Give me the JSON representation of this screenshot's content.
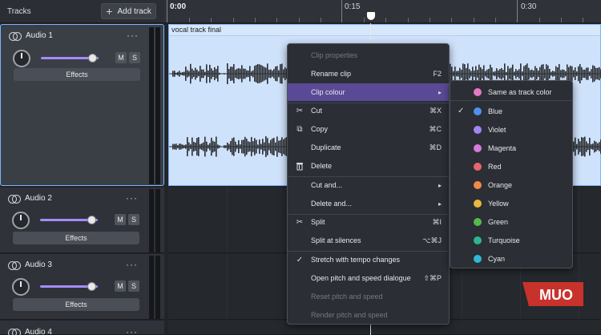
{
  "header": {
    "title": "Tracks",
    "add_track_label": "Add track"
  },
  "timeline": {
    "labels": [
      "0:00",
      "0:15",
      "0:30"
    ]
  },
  "tracks": [
    {
      "name": "Audio 1",
      "mute": "M",
      "solo": "S",
      "effects": "Effects",
      "menu": "···",
      "volume": 0.9
    },
    {
      "name": "Audio 2",
      "mute": "M",
      "solo": "S",
      "effects": "Effects",
      "menu": "···",
      "volume": 0.9
    },
    {
      "name": "Audio 3",
      "mute": "M",
      "solo": "S",
      "effects": "Effects",
      "menu": "···",
      "volume": 0.9
    },
    {
      "name": "Audio 4",
      "menu": "···"
    }
  ],
  "clip": {
    "title": "vocal track final",
    "color": "#cfe2fb"
  },
  "context_menu": {
    "items": [
      {
        "label": "Clip properties",
        "shortcut": "",
        "disabled": true
      },
      {
        "label": "Rename clip",
        "shortcut": "F2"
      },
      {
        "label": "Clip colour",
        "shortcut": "▸",
        "highlight": true
      },
      {
        "label": "Cut",
        "shortcut": "⌘X",
        "icon": "scissors-icon"
      },
      {
        "label": "Copy",
        "shortcut": "⌘C",
        "icon": "copy-icon"
      },
      {
        "label": "Duplicate",
        "shortcut": "⌘D"
      },
      {
        "label": "Delete",
        "shortcut": "",
        "icon": "trash-icon"
      },
      {
        "label": "Cut and...",
        "shortcut": "▸"
      },
      {
        "label": "Delete and...",
        "shortcut": "▸"
      },
      {
        "label": "Split",
        "shortcut": "⌘I",
        "icon": "split-icon"
      },
      {
        "label": "Split at silences",
        "shortcut": "⌥⌘J"
      },
      {
        "label": "Stretch with tempo changes",
        "shortcut": "",
        "checked": true
      },
      {
        "label": "Open pitch and speed dialogue",
        "shortcut": "⇧⌘P"
      },
      {
        "label": "Reset pitch and speed",
        "shortcut": "",
        "disabled": true
      },
      {
        "label": "Render pitch and speed",
        "shortcut": "",
        "disabled": true
      }
    ]
  },
  "colour_menu": {
    "items": [
      {
        "label": "Same as track color",
        "color": "#e37ac4"
      },
      {
        "label": "Blue",
        "color": "#4e8ff0",
        "checked": true
      },
      {
        "label": "Violet",
        "color": "#9f86f0"
      },
      {
        "label": "Magenta",
        "color": "#d77ad9"
      },
      {
        "label": "Red",
        "color": "#e4676a"
      },
      {
        "label": "Orange",
        "color": "#ef8a47"
      },
      {
        "label": "Yellow",
        "color": "#e9b73a"
      },
      {
        "label": "Green",
        "color": "#56b94b"
      },
      {
        "label": "Turquoise",
        "color": "#2fb48f"
      },
      {
        "label": "Cyan",
        "color": "#31b8d6"
      }
    ]
  },
  "watermark": {
    "text": "MUO",
    "color": "#c8322c"
  }
}
